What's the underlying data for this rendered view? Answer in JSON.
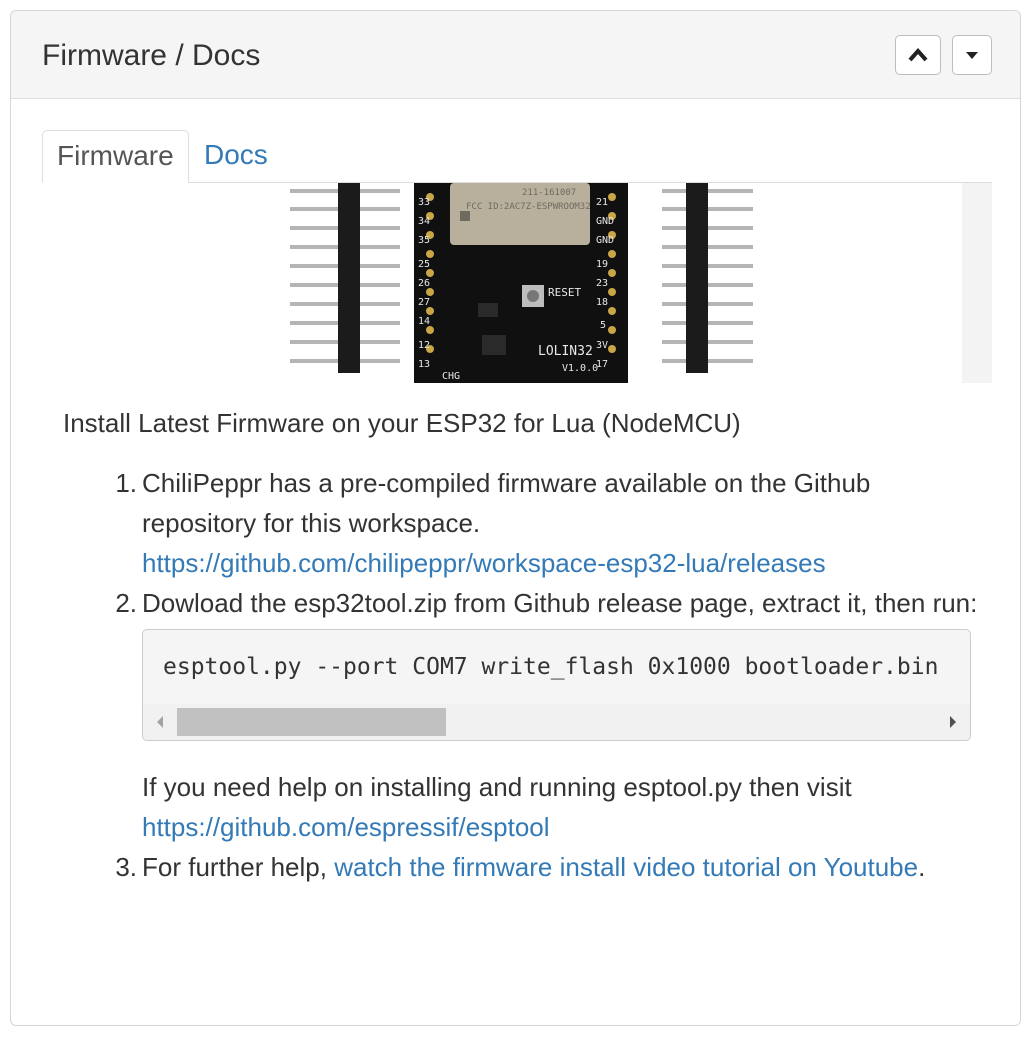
{
  "panel": {
    "title": "Firmware / Docs",
    "collapse_button": "collapse",
    "menu_button": "menu"
  },
  "tabs": [
    {
      "label": "Firmware",
      "active": true
    },
    {
      "label": "Docs",
      "active": false
    }
  ],
  "image": {
    "board_text": "LOLIN32",
    "board_version": "V1.0.0",
    "reset_label": "RESET",
    "chip_text": "FCC ID:2AC7Z-ESPWROOM32",
    "cert_text": "211-161007",
    "chg_label": "CHG",
    "left_pins": [
      "33",
      "34",
      "35",
      "25",
      "26",
      "27",
      "14",
      "12",
      "13"
    ],
    "right_pins": [
      "21",
      "GND",
      "GND",
      "19",
      "23",
      "18",
      "5",
      "3V",
      "17"
    ]
  },
  "content": {
    "intro": "Install Latest Firmware on your ESP32 for Lua (NodeMCU)",
    "step1_text": "ChiliPeppr has a pre-compiled firmware available on the Github repository for this workspace.",
    "step1_link": "https://github.com/chilipeppr/workspace-esp32-lua/releases",
    "step2_text": "Dowload the esp32tool.zip from Github release page, extract it, then run:",
    "code": "esptool.py --port COM7 write_flash 0x1000 bootloader.bin",
    "step2_help": "If you need help on installing and running esptool.py then visit",
    "step2_link": "https://github.com/espressif/esptool",
    "step3_text": "For further help, ",
    "step3_link": "watch the firmware install video tutorial on Youtube",
    "step3_end": "."
  },
  "colors": {
    "link": "#337ab7",
    "text": "#333333",
    "heading_bg": "#f5f5f5"
  }
}
